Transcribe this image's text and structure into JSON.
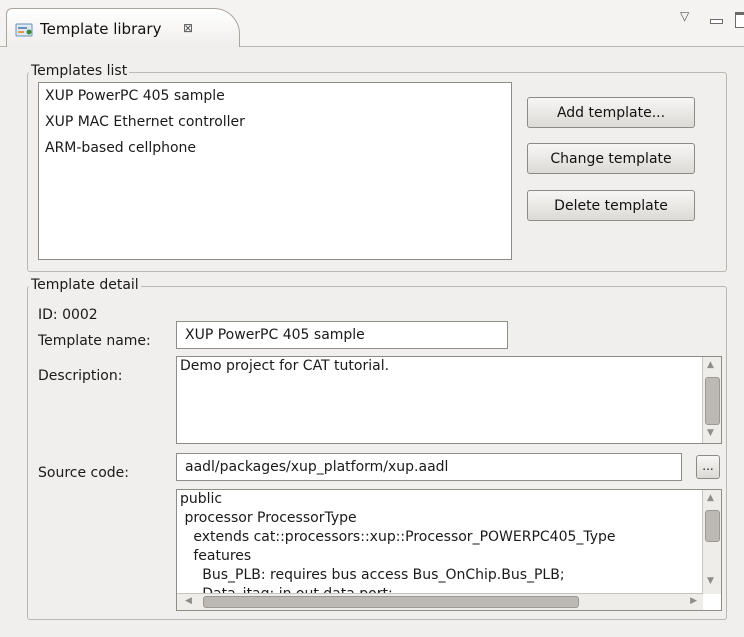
{
  "tab": {
    "title": "Template library",
    "close_glyph": "⊠"
  },
  "window_controls": {
    "view_menu_glyph": "▽"
  },
  "templates_list": {
    "title": "Templates list",
    "items": [
      "XUP PowerPC 405 sample",
      "XUP MAC Ethernet controller",
      "ARM-based cellphone"
    ],
    "add_button": "Add template...",
    "change_button": "Change template",
    "delete_button": "Delete template"
  },
  "template_detail": {
    "title": "Template detail",
    "id_label": "ID: 0002",
    "name_label": "Template name:",
    "name_value": "XUP PowerPC 405 sample",
    "description_label": "Description:",
    "description_value": "Demo project for CAT tutorial.",
    "source_label": "Source code:",
    "source_value": "aadl/packages/xup_platform/xup.aadl",
    "browse_label": "...",
    "code_lines": [
      "public",
      " processor ProcessorType",
      "   extends cat::processors::xup::Processor_POWERPC405_Type",
      "   features",
      "     Bus_PLB: requires bus access Bus_OnChip.Bus_PLB;",
      "     Data_jtag: in out data port;"
    ]
  },
  "colors": {
    "tab_bg": "#ffffff",
    "panel_bg": "#f0efee",
    "border": "#8f8d88"
  },
  "icons": {
    "tab": "template-library-icon"
  }
}
